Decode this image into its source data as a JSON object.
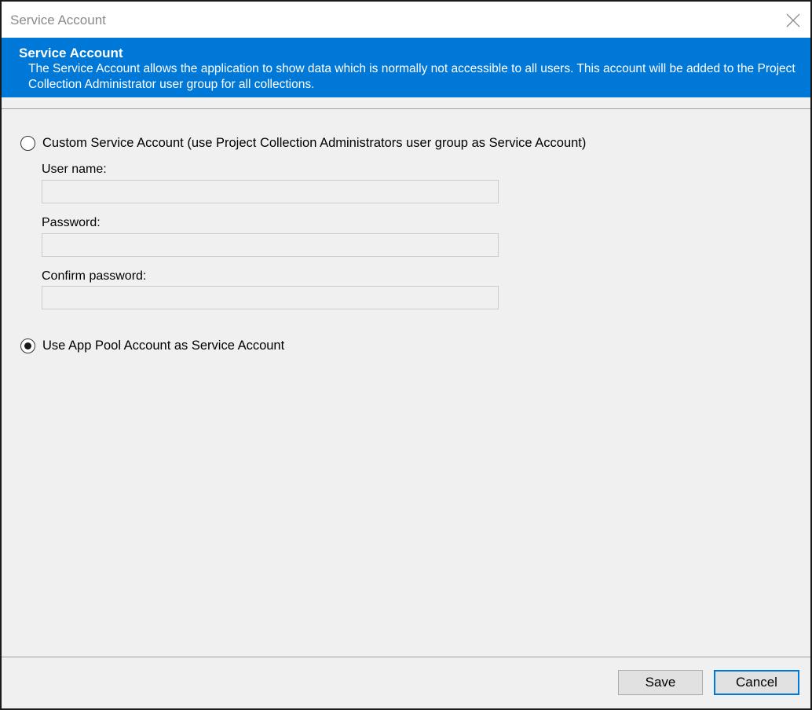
{
  "window": {
    "title": "Service Account"
  },
  "banner": {
    "title": "Service Account",
    "description": "The Service Account allows the application to show data which is normally not accessible to all users. This account will be added to the Project Collection Administrator user group for all collections."
  },
  "options": {
    "custom": {
      "label": "Custom Service Account (use Project Collection Administrators user group as Service Account)",
      "selected": false
    },
    "app_pool": {
      "label": "Use App Pool Account as Service Account",
      "selected": true
    }
  },
  "fields": {
    "username": {
      "label": "User name:",
      "value": ""
    },
    "password": {
      "label": "Password:",
      "value": ""
    },
    "confirm": {
      "label": "Confirm password:",
      "value": ""
    }
  },
  "buttons": {
    "save": "Save",
    "cancel": "Cancel"
  },
  "colors": {
    "accent": "#0078d7",
    "background": "#f0f0f0"
  },
  "icons": {
    "close": "close-icon"
  }
}
